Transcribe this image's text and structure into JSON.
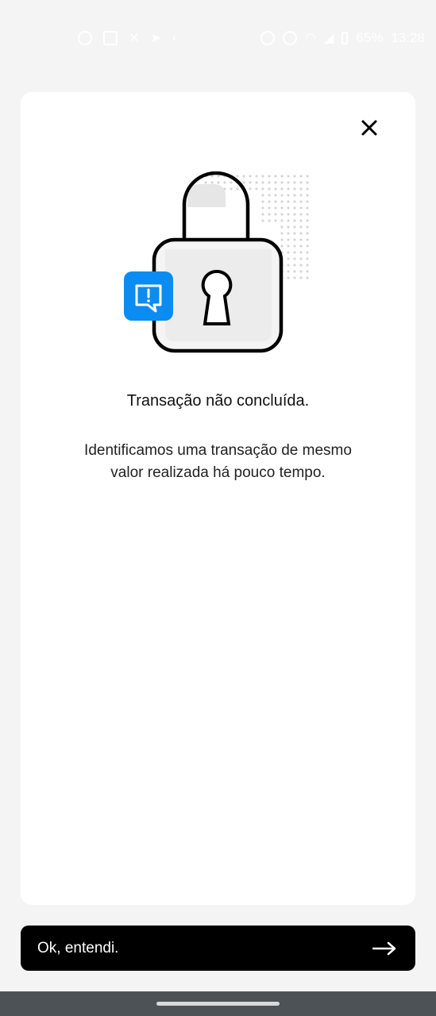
{
  "status_bar": {
    "battery_text": "65%",
    "time": "13:28",
    "left_icons": [
      "whatsapp-icon",
      "message-icon",
      "tools-icon",
      "telegram-icon",
      "chevron-left-icon"
    ],
    "right_icons": [
      "alarm-icon",
      "mute-icon",
      "wifi-icon",
      "signal-icon",
      "battery-icon"
    ]
  },
  "dialog": {
    "close_icon": "close-icon",
    "illustration_icon": "padlock-alert-icon",
    "title": "Transação não concluída.",
    "message": "Identificamos uma transação de mesmo valor realizada há pouco tempo."
  },
  "action": {
    "label": "Ok, entendi.",
    "icon": "arrow-right-icon"
  },
  "colors": {
    "background": "#f4f4f4",
    "card": "#ffffff",
    "accent_blue": "#0a8cf2",
    "button": "#000000",
    "nav_bar": "#4d5257"
  }
}
